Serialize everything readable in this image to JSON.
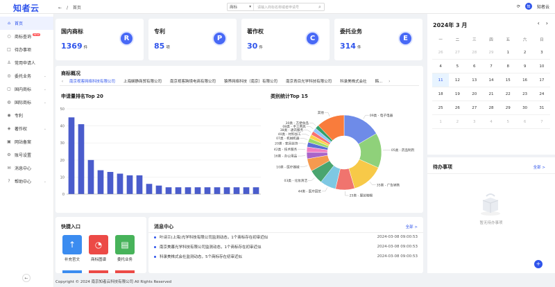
{
  "header": {
    "logo": "知者云",
    "breadcrumb_home": "首页",
    "search_type": "商标",
    "search_placeholder": "请输入商标名称或者申请号",
    "user_name": "知者云"
  },
  "sidebar": {
    "items": [
      {
        "label": "首页",
        "icon": "home-icon",
        "glyph": "⌂",
        "active": true
      },
      {
        "label": "商标查询",
        "icon": "search-icon",
        "glyph": "○",
        "hot": "NEW"
      },
      {
        "label": "待办事项",
        "icon": "todo-icon",
        "glyph": "□"
      },
      {
        "label": "常用申请人",
        "icon": "user-icon",
        "glyph": "♙"
      },
      {
        "label": "委托业务",
        "icon": "commission-icon",
        "glyph": "◎",
        "chev": true
      },
      {
        "label": "国内商标",
        "icon": "domestic-icon",
        "glyph": "▢",
        "chev": true
      },
      {
        "label": "国际商标",
        "icon": "globe-icon",
        "glyph": "◍",
        "chev": true
      },
      {
        "label": "专利",
        "icon": "patent-icon",
        "glyph": "◉"
      },
      {
        "label": "著作权",
        "icon": "copyright-icon",
        "glyph": "◈",
        "chev": true
      },
      {
        "label": "网站备案",
        "icon": "website-icon",
        "glyph": "▣"
      },
      {
        "label": "账号设置",
        "icon": "settings-icon",
        "glyph": "⚙"
      },
      {
        "label": "消息中心",
        "icon": "message-icon",
        "glyph": "✉"
      },
      {
        "label": "帮助中心",
        "icon": "help-icon",
        "glyph": "?",
        "chev": true
      }
    ]
  },
  "stats": [
    {
      "label": "国内商标",
      "value": "1369",
      "unit": "件",
      "badge": "R"
    },
    {
      "label": "专利",
      "value": "85",
      "unit": "项",
      "badge": "P"
    },
    {
      "label": "著作权",
      "value": "30",
      "unit": "件",
      "badge": "C"
    },
    {
      "label": "委托业务",
      "value": "314",
      "unit": "件",
      "badge": "E"
    }
  ],
  "overview": {
    "title": "商标概况",
    "tabs": [
      "南京视客网络科技有限公司",
      "上海娴静商贸有限公司",
      "南京视客跨境电商有限公司",
      "猿界网络科技（南京）有限公司",
      "南京青目光学科技有限公司",
      "科录美株式会社",
      "韩..."
    ],
    "bar_title": "申请量排名Top 20",
    "pie_title": "类别统计Top 15"
  },
  "colors": {
    "accent": "#2f54eb",
    "bar": "#4a5ccc"
  },
  "chart_data": [
    {
      "type": "bar",
      "title": "申请量排名Top 20",
      "categories": [
        "",
        "",
        "",
        "",
        "",
        "",
        "",
        "",
        "",
        "",
        "",
        "",
        "",
        "",
        "",
        "",
        "",
        "",
        "",
        ""
      ],
      "values": [
        45,
        41,
        20,
        14,
        13,
        12,
        11,
        11,
        6,
        5,
        4,
        4,
        4,
        4,
        4,
        4,
        4,
        4,
        4,
        4
      ],
      "ylim": [
        0,
        50
      ],
      "yticks": [
        0,
        10,
        20,
        30,
        40,
        50
      ]
    },
    {
      "type": "pie",
      "title": "类别统计Top 15",
      "slices": [
        {
          "label": "09类 - 电子电器",
          "value": 120,
          "color": "#6e8be8"
        },
        {
          "label": "05类 - 药品制剂",
          "value": 110,
          "color": "#8fd17a"
        },
        {
          "label": "35类 - 广告销售",
          "value": 100,
          "color": "#f7c948"
        },
        {
          "label": "25类 - 服装鞋帽",
          "value": 60,
          "color": "#f0746e"
        },
        {
          "label": "44类 - 医疗园艺",
          "value": 50,
          "color": "#7ec8e3"
        },
        {
          "label": "03类 - 化妆清洁",
          "value": 45,
          "color": "#4aa56f"
        },
        {
          "label": "10类 - 医疗器械",
          "value": 40,
          "color": "#f59a4f"
        },
        {
          "label": "16类 - 办公用品",
          "value": 20,
          "color": "#a865c9"
        },
        {
          "label": "42类 - 技术服务",
          "value": 17,
          "color": "#ef7ec3"
        },
        {
          "label": "20类 - 家具装饰",
          "value": 15,
          "color": "#5b6ed6"
        },
        {
          "label": "07类 - 机械机器",
          "value": 13,
          "color": "#9bd96a"
        },
        {
          "label": "40类 - 材料加工",
          "value": 12,
          "color": "#fcd34d"
        },
        {
          "label": "38类 - 通讯服务",
          "value": 12,
          "color": "#f87171"
        },
        {
          "label": "08类 - 手工用具",
          "value": 12,
          "color": "#93c5fd"
        },
        {
          "label": "30类 - 方便食品",
          "value": 12,
          "color": "#34a06a"
        },
        {
          "label": "其他",
          "value": 88,
          "color": "#f97c3c"
        }
      ]
    }
  ],
  "quick_entry": {
    "title": "快捷入口",
    "items": [
      {
        "label": "补充官文",
        "icon": "upload-icon",
        "glyph": "↑",
        "color": "#3b8cf0"
      },
      {
        "label": "商标图谱",
        "icon": "pie-chart-icon",
        "glyph": "◔",
        "color": "#ec4a46"
      },
      {
        "label": "委托业务",
        "icon": "clipboard-icon",
        "glyph": "▤",
        "color": "#47b35a"
      }
    ]
  },
  "messages": {
    "title": "消息中心",
    "all_label": "全部 >",
    "items": [
      {
        "text": "叶诗兰(上海)光学科技有限公司监测动态，1个商标存在初审近似",
        "time": "2024-03-08 09:00:53"
      },
      {
        "text": "南京美暮光学科技有限公司监测动态，1个商标存在初审近似",
        "time": "2024-03-08 09:00:53"
      },
      {
        "text": "科录美株式会社监测动态，5个商标存在初审近似",
        "time": "2024-03-08 09:00:53"
      }
    ]
  },
  "calendar": {
    "title": "2024年 3 月",
    "weekdays": [
      "一",
      "二",
      "三",
      "四",
      "五",
      "六",
      "日"
    ],
    "days": [
      {
        "d": "26",
        "m": true
      },
      {
        "d": "27",
        "m": true
      },
      {
        "d": "28",
        "m": true
      },
      {
        "d": "29",
        "m": true
      },
      {
        "d": "1"
      },
      {
        "d": "2"
      },
      {
        "d": "3"
      },
      {
        "d": "4"
      },
      {
        "d": "5"
      },
      {
        "d": "6"
      },
      {
        "d": "7"
      },
      {
        "d": "8"
      },
      {
        "d": "9"
      },
      {
        "d": "10"
      },
      {
        "d": "11",
        "t": true
      },
      {
        "d": "12"
      },
      {
        "d": "13"
      },
      {
        "d": "14"
      },
      {
        "d": "15"
      },
      {
        "d": "16"
      },
      {
        "d": "17"
      },
      {
        "d": "18"
      },
      {
        "d": "19"
      },
      {
        "d": "20"
      },
      {
        "d": "21"
      },
      {
        "d": "22"
      },
      {
        "d": "23"
      },
      {
        "d": "24"
      },
      {
        "d": "25"
      },
      {
        "d": "26"
      },
      {
        "d": "27"
      },
      {
        "d": "28"
      },
      {
        "d": "29"
      },
      {
        "d": "30"
      },
      {
        "d": "31"
      },
      {
        "d": "1",
        "m": true
      },
      {
        "d": "2",
        "m": true
      },
      {
        "d": "3",
        "m": true
      },
      {
        "d": "4",
        "m": true
      },
      {
        "d": "5",
        "m": true
      },
      {
        "d": "6",
        "m": true
      },
      {
        "d": "7",
        "m": true
      }
    ]
  },
  "todo": {
    "title": "待办事项",
    "all_label": "全部 >",
    "empty": "暂无待办事项"
  },
  "footer": "Copyright © 2024 南京知者云科技有限公司 All Rights Reserved"
}
